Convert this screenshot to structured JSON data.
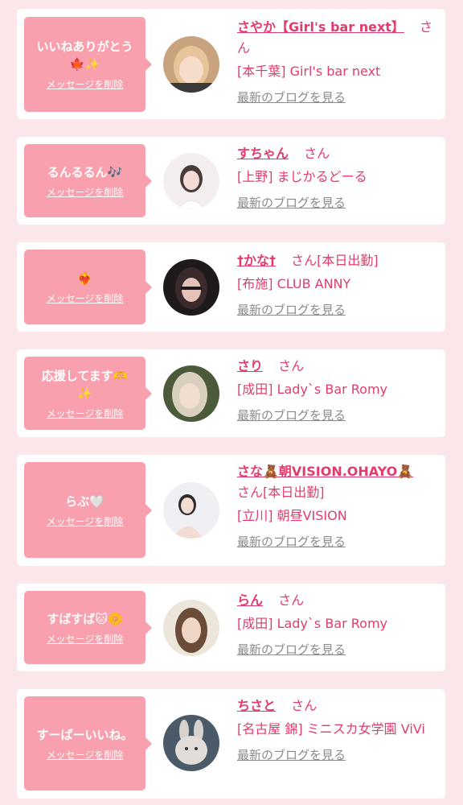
{
  "delete_label": "メッセージを削除",
  "blog_label": "最新のブログを見る",
  "san_label": "さん",
  "colors": {
    "background": "#fbe7ea",
    "bubble": "#f8a0ad",
    "accent": "#e23c6c",
    "muted": "#8a8a8a"
  },
  "entries": [
    {
      "message": "いいねありがとう\n🍁✨",
      "name": "さやか【Girl's bar next】",
      "status": "",
      "shop": "[本千葉] Girl's bar next"
    },
    {
      "message": "るんるるん🎶",
      "name": "すちゃん",
      "status": "",
      "shop": "[上野] まじかるどーる"
    },
    {
      "message": "❤️‍🔥",
      "name": "†かな†",
      "status": "[本日出勤]",
      "shop": "[布施] CLUB ANNY"
    },
    {
      "message": "応援してます🫶\n✨",
      "name": "さり",
      "status": "",
      "shop": "[成田] Lady`s Bar Romy"
    },
    {
      "message": "らぶ🤍",
      "name": "さな🧸朝VISION.OHAYO🧸",
      "status": "[本日出勤]",
      "shop": "[立川] 朝昼VISION"
    },
    {
      "message": "すばすば🐱🌼",
      "name": "らん",
      "status": "",
      "shop": "[成田] Lady`s Bar Romy"
    },
    {
      "message": "すーぱーいいね。",
      "name": "ちさと",
      "status": "",
      "shop": "[名古屋 錦] ミニスカ女学園 ViVi"
    }
  ]
}
